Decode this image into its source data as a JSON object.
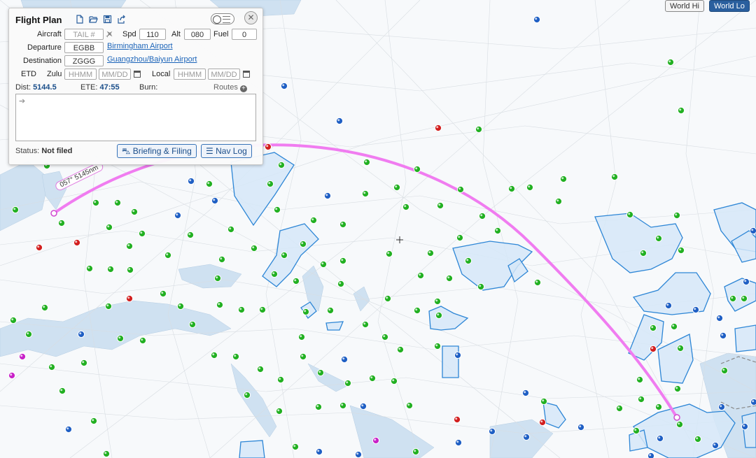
{
  "panel": {
    "title": "Flight Plan",
    "aircraft_label": "Aircraft",
    "aircraft_placeholder": "TAIL #",
    "spd_label": "Spd",
    "spd_value": "110",
    "alt_label": "Alt",
    "alt_value": "080",
    "fuel_label": "Fuel",
    "fuel_value": "0",
    "departure_label": "Departure",
    "departure_value": "EGBB",
    "departure_name": "Birmingham Airport",
    "destination_label": "Destination",
    "destination_value": "ZGGG",
    "destination_name": "Guangzhou/Baiyun Airport",
    "etd_label": "ETD",
    "zulu_label": "Zulu",
    "time_placeholder": "HHMM",
    "date_placeholder": "MM/DD",
    "local_label": "Local",
    "dist_label": "Dist:",
    "dist_value": "5144.5",
    "ete_label": "ETE:",
    "ete_value": "47:55",
    "burn_label": "Burn:",
    "routes_label": "Routes",
    "status_label": "Status:",
    "status_value": "Not filed",
    "briefing_button": "Briefing & Filing",
    "navlog_button": "Nav Log"
  },
  "map_buttons": {
    "world_hi": "World Hi",
    "world_lo": "World Lo"
  },
  "route_label": "057° 5145nm",
  "colors": {
    "route": "#f07cf0",
    "airspace_fill": "#d6e8f8",
    "airspace_stroke": "#2d86d6",
    "water": "#c9dff0",
    "green_marker": "#22b022",
    "blue_marker": "#1f5fc4",
    "red_marker": "#d21f1f",
    "magenta_marker": "#c822c8"
  },
  "icons": [
    "file-icon",
    "folder-open-icon",
    "save-icon",
    "share-icon",
    "plane-icon",
    "calendar-icon",
    "plus-circle-icon",
    "car-icon",
    "list-icon",
    "close-icon",
    "crosshair-icon"
  ]
}
